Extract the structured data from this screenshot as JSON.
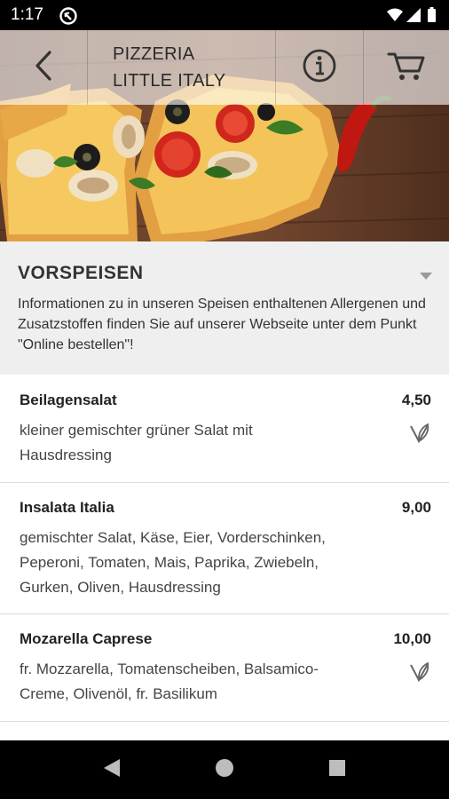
{
  "status_bar": {
    "time": "1:17"
  },
  "header": {
    "title_line1": "PIZZERIA",
    "title_line2": "LITTLE ITALY"
  },
  "category": {
    "title": "VORSPEISEN",
    "info": "Informationen zu in unseren Speisen enthaltenen Allergenen und Zusatzstoffen finden Sie auf unserer Webseite unter dem Punkt \"Online bestellen\"!"
  },
  "items": [
    {
      "name": "Beilagensalat",
      "price": "4,50",
      "desc_line1": "kleiner gemischter grüner Salat mit",
      "desc_line2": "Hausdressing",
      "vegetarian": true
    },
    {
      "name": "Insalata Italia",
      "price": "9,00",
      "desc_line1": "gemischter Salat, Käse, Eier, Vorderschinken,",
      "desc_line2": "Peperoni, Tomaten, Mais, Paprika, Zwiebeln,",
      "desc_line3": "Gurken, Oliven, Hausdressing",
      "vegetarian": false
    },
    {
      "name": "Mozarella Caprese",
      "price": "10,00",
      "desc_line1": "fr. Mozzarella, Tomatenscheiben, Balsamico-",
      "desc_line2": "Creme, Olivenöl, fr. Basilikum",
      "vegetarian": true
    }
  ],
  "icons": {
    "back": "back-arrow-icon",
    "info": "info-icon",
    "cart": "cart-icon",
    "vegetarian": "vegetarian-leaf-icon",
    "expand": "dropdown-triangle-icon"
  },
  "colors": {
    "category_bg": "#efefef",
    "divider": "#dcdcdc"
  }
}
